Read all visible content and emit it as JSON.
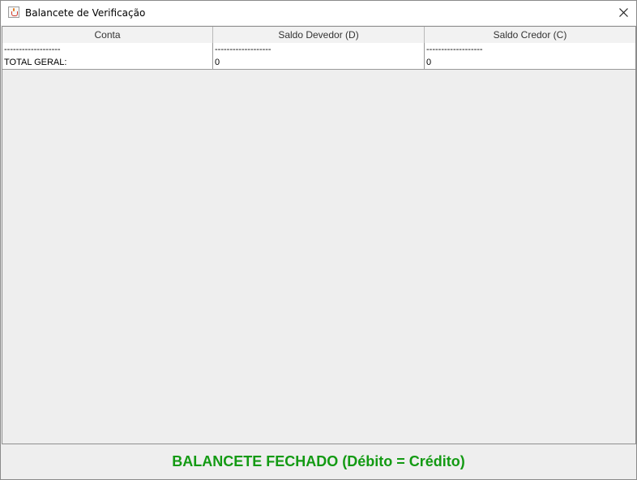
{
  "window": {
    "title": "Balancete de Verificação",
    "icon": "java-cup-icon",
    "close_icon": "close-icon"
  },
  "table": {
    "columns": [
      "Conta",
      "Saldo Devedor (D)",
      "Saldo Credor (C)"
    ],
    "rows": [
      [
        "-------------------",
        "-------------------",
        "-------------------"
      ],
      [
        "TOTAL GERAL:",
        "0",
        "0"
      ]
    ]
  },
  "status": {
    "text": "BALANCETE FECHADO (Débito = Crédito)",
    "color": "#139a13"
  }
}
